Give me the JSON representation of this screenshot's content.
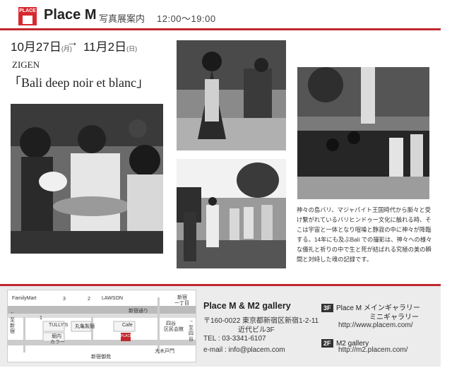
{
  "header": {
    "logo_text": "PLACE",
    "brand": "Place M",
    "subtitle": "写真展案内",
    "hours": "12:00〜19:00"
  },
  "exhibition": {
    "date_from_main": "10月27日",
    "date_from_day": "(月)",
    "date_to_main": "11月2日",
    "date_to_day": "(日)",
    "arrow": "→",
    "artist": "ZIGEN",
    "title": "「Bali deep  noir et blanc」",
    "description": "神々の島バリ、マジャパイト王国時代から脈々と受け繋がれているバリヒンドゥー文化に触れる時、そこは宇宙と一体となり喧噪と静寂の中に神々が降臨する。14年にも及ぶBali での撮影は、神々への様々な儀礼と祈りの中で生と死が結ばれる究極の美の瞬間と対峙した魂の記録です。"
  },
  "map": {
    "familymart": "FamilyMart",
    "lawson": "LAWSON",
    "shinjuku_1": "新宿",
    "shinjuku_2": "一丁目",
    "marunouchi": "丸ノ内線 新宿御苑前",
    "shinjuku_dori": "新宿通り",
    "west_arrow": "←",
    "west_1": "至",
    "west_2": "新",
    "west_3": "宿",
    "east_arrow": "→",
    "east_1": "至",
    "east_2": "四",
    "east_3": "谷",
    "exit_2": "2",
    "exit_3": "3",
    "exit_1": "1",
    "tullys": "TULLY'S",
    "marugame": "丸亀製麺",
    "cafe": "Cafe",
    "yotsuya_1": "四谷",
    "yotsuya_2": "区民会館",
    "curry_1": "堀内",
    "curry_2": "カラー",
    "logo": "PLACE",
    "okido": "大木戸門",
    "gyoen": "新宿御苑"
  },
  "contact": {
    "name": "Place M & M2 gallery",
    "postal": "〒160-0022 東京都新宿区新宿1-2-11",
    "building": "近代ビル3F",
    "tel": "TEL : 03-3341-6107",
    "email": "e-mail : info@placem.com"
  },
  "galleries": [
    {
      "floor": "3F",
      "line1": "Place M メインギャラリー",
      "line2": "ミニギャラリー",
      "url": "http://www.placem.com/"
    },
    {
      "floor": "2F",
      "line1": "M2 gallery",
      "url": "http://m2.placem.com/"
    }
  ]
}
